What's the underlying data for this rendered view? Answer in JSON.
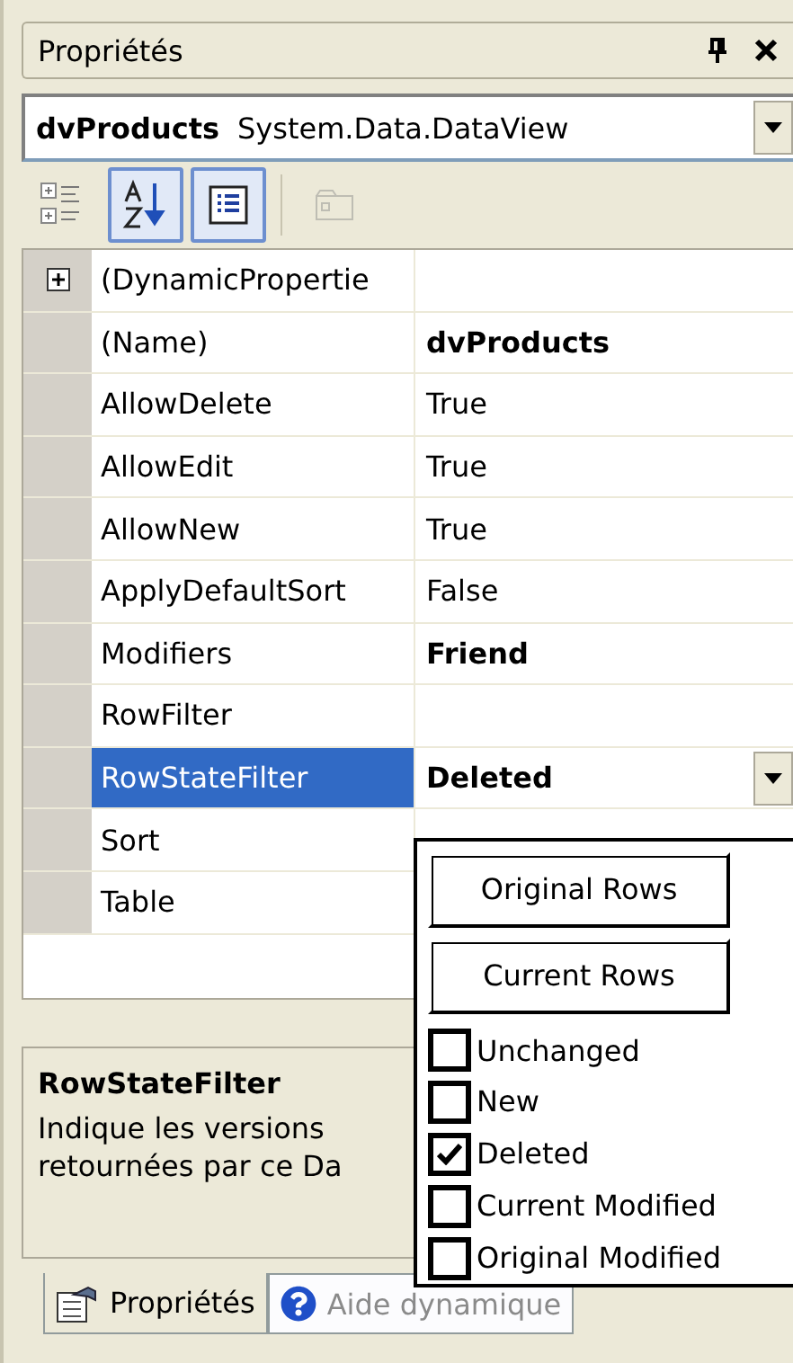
{
  "window": {
    "title": "Propriétés"
  },
  "object_selector": {
    "name": "dvProducts",
    "type": "System.Data.DataView"
  },
  "toolbar": [
    {
      "kind": "categorized",
      "pressed": false,
      "disabled": false
    },
    {
      "kind": "alphabetical",
      "pressed": true,
      "disabled": false
    },
    {
      "kind": "properties",
      "pressed": true,
      "disabled": false
    },
    {
      "kind": "property-pages",
      "pressed": false,
      "disabled": true
    }
  ],
  "properties": [
    {
      "name": "(DynamicPropertie",
      "selected": false,
      "expandable": true,
      "expanded": false
    },
    {
      "name": "(Name)",
      "value": "dvProducts",
      "modified": true,
      "selected": false
    },
    {
      "name": "AllowDelete",
      "value": "True",
      "modified": false,
      "selected": false
    },
    {
      "name": "AllowEdit",
      "value": "True",
      "modified": false,
      "selected": false
    },
    {
      "name": "AllowNew",
      "value": "True",
      "modified": false,
      "selected": false
    },
    {
      "name": "ApplyDefaultSort",
      "value": "False",
      "modified": false,
      "selected": false
    },
    {
      "name": "Modifiers",
      "value": "Friend",
      "modified": true,
      "selected": false
    },
    {
      "name": "RowFilter",
      "selected": false
    },
    {
      "name": "RowStateFilter",
      "value": "Deleted",
      "modified": true,
      "selected": true
    },
    {
      "name": "Sort",
      "selected": false
    },
    {
      "name": "Table",
      "selected": false
    }
  ],
  "dropdown": [
    {
      "kind": "button",
      "label": "Original Rows"
    },
    {
      "kind": "button",
      "label": "Current Rows"
    },
    {
      "kind": "checkbox",
      "label": "Unchanged",
      "checked": false
    },
    {
      "kind": "checkbox",
      "label": "New",
      "checked": false
    },
    {
      "kind": "checkbox",
      "label": "Deleted",
      "checked": true
    },
    {
      "kind": "checkbox",
      "label": "Current Modified",
      "checked": false
    },
    {
      "kind": "checkbox",
      "label": "Original Modified",
      "checked": false
    }
  ],
  "description": {
    "title": "RowStateFilter",
    "lines": [
      "Indique les versions",
      "retournées par ce Da"
    ]
  },
  "tabs": [
    {
      "label": "Propriétés",
      "selected": true
    },
    {
      "label": "Aide dynamique",
      "selected": false
    }
  ]
}
